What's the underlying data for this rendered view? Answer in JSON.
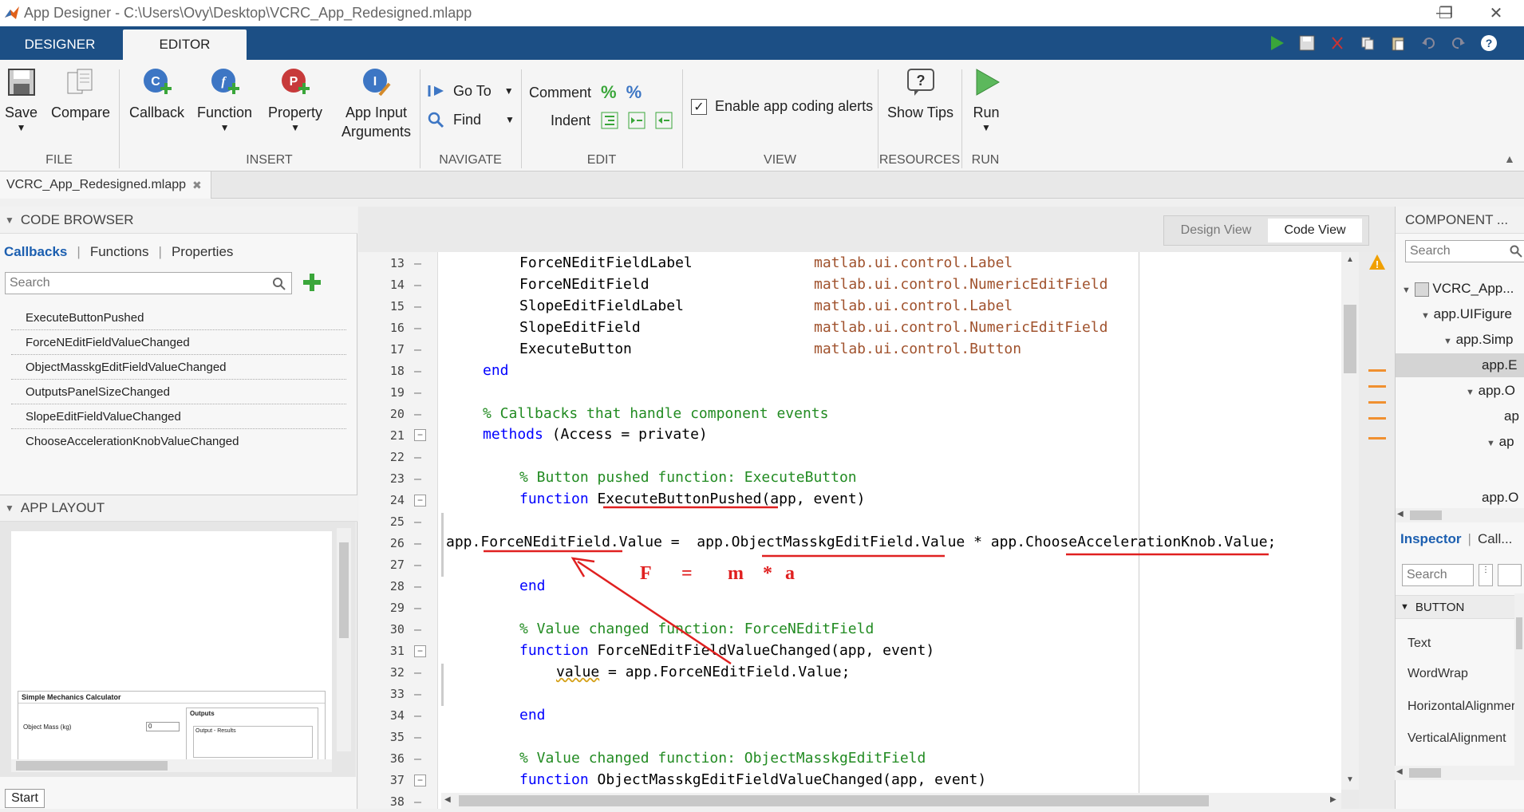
{
  "window": {
    "title": "App Designer - C:\\Users\\Ovy\\Desktop\\VCRC_App_Redesigned.mlapp",
    "min": "—",
    "max": "❐",
    "close": "✕"
  },
  "tabs": {
    "designer": "DESIGNER",
    "editor": "EDITOR"
  },
  "ribbon": {
    "save": "Save",
    "compare": "Compare",
    "callback": "Callback",
    "function": "Function",
    "property": "Property",
    "app_input_1": "App Input",
    "app_input_2": "Arguments",
    "goto": "Go To",
    "find": "Find",
    "comment": "Comment",
    "indent": "Indent",
    "enable_alerts": "Enable app coding alerts",
    "show_tips": "Show Tips",
    "run": "Run",
    "groups": {
      "file": "FILE",
      "insert": "INSERT",
      "navigate": "NAVIGATE",
      "edit": "EDIT",
      "view": "VIEW",
      "resources": "RESOURCES",
      "run": "RUN"
    }
  },
  "doc_tab": {
    "name": "VCRC_App_Redesigned.mlapp",
    "close": "✖"
  },
  "code_browser": {
    "header": "CODE BROWSER",
    "tabs": [
      "Callbacks",
      "Functions",
      "Properties"
    ],
    "search_placeholder": "Search",
    "items": [
      "ExecuteButtonPushed",
      "ForceNEditFieldValueChanged",
      "ObjectMasskgEditFieldValueChanged",
      "OutputsPanelSizeChanged",
      "SlopeEditFieldValueChanged",
      "ChooseAccelerationKnobValueChanged"
    ]
  },
  "app_layout": {
    "header": "APP LAYOUT",
    "preview_title": "Simple Mechanics Calculator",
    "preview_label": "Object Mass (kg)",
    "preview_value": "0",
    "preview_outputs": "Outputs",
    "preview_results": "Output - Results"
  },
  "start_button": "Start",
  "view_toggle": {
    "design": "Design View",
    "code": "Code View"
  },
  "code_lines": [
    {
      "n": "13",
      "name": "ForceNEditFieldLabel",
      "type": "matlab.ui.control.Label"
    },
    {
      "n": "14",
      "name": "ForceNEditField",
      "type": "matlab.ui.control.NumericEditField"
    },
    {
      "n": "15",
      "name": "SlopeEditFieldLabel",
      "type": "matlab.ui.control.Label"
    },
    {
      "n": "16",
      "name": "SlopeEditField",
      "type": "matlab.ui.control.NumericEditField"
    },
    {
      "n": "17",
      "name": "ExecuteButton",
      "type": "matlab.ui.control.Button"
    }
  ],
  "code": {
    "l18": "end",
    "l20": "% Callbacks that handle component events",
    "l21_kw": "methods",
    "l21_rest": " (Access = private)",
    "l23": "% Button pushed function: ExecuteButton",
    "l24_kw": "function",
    "l24_name": "ExecuteButtonPushed",
    "l24_rest": "(app, event)",
    "l26_a": "app.",
    "l26_b": "ForceNEditField",
    "l26_c": ".Value =  app.",
    "l26_d": "ObjectMasskgEditField",
    "l26_e": ".Value * app.",
    "l26_f": "ChooseAccelerationKnob",
    "l26_g": ".Value;",
    "l28": "end",
    "l30": "% Value changed function: ForceNEditField",
    "l31_kw": "function",
    "l31_rest": " ForceNEditFieldValueChanged(app, event)",
    "l32_a": "value",
    "l32_b": " = app.ForceNEditField.Value;",
    "l34": "end",
    "l36": "% Value changed function: ObjectMasskgEditField",
    "l37_kw": "function",
    "l37_rest": " ObjectMasskgEditFieldValueChanged(app, event)"
  },
  "line_numbers": [
    "13",
    "14",
    "15",
    "16",
    "17",
    "18",
    "19",
    "20",
    "21",
    "22",
    "23",
    "24",
    "25",
    "26",
    "27",
    "28",
    "29",
    "30",
    "31",
    "32",
    "33",
    "34",
    "35",
    "36",
    "37",
    "38"
  ],
  "annotation": {
    "f": "F",
    "eq": "=",
    "m": "m",
    "star": "*",
    "a": "a"
  },
  "component_browser": {
    "header": "COMPONENT ...",
    "search_placeholder": "Search",
    "tree": [
      "VCRC_App...",
      "app.UIFigure",
      "app.Simp",
      "app.E",
      "app.O",
      "ap",
      "ap",
      "app.O"
    ]
  },
  "inspector": {
    "tabs": [
      "Inspector",
      "Call..."
    ],
    "search_placeholder": "Search",
    "section": "BUTTON",
    "props": [
      "Text",
      "WordWrap",
      "HorizontalAlignmer",
      "VerticalAlignment"
    ]
  }
}
